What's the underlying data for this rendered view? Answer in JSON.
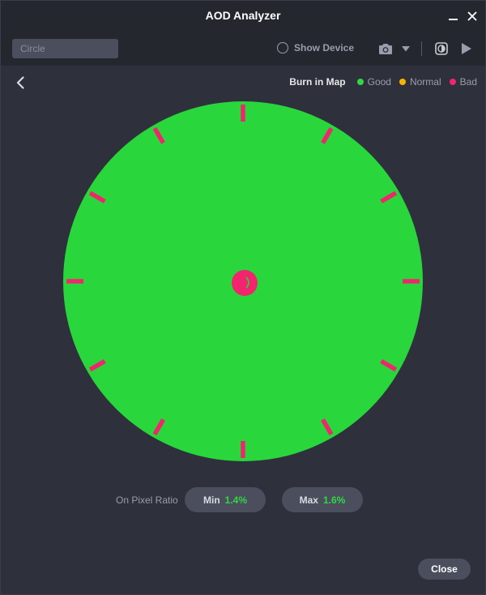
{
  "window": {
    "title": "AOD Analyzer"
  },
  "toolbar": {
    "search_placeholder": "Circle",
    "show_device_label": "Show Device"
  },
  "legend": {
    "title": "Burn in Map",
    "items": [
      {
        "label": "Good",
        "color": "#31d843"
      },
      {
        "label": "Normal",
        "color": "#f5b400"
      },
      {
        "label": "Bad",
        "color": "#f0256e"
      }
    ]
  },
  "burn_map": {
    "shape": "circle",
    "good_color": "#29d63c",
    "bad_color": "#f0256e",
    "hour_marks": 12
  },
  "pixel_ratio": {
    "label": "On Pixel Ratio",
    "min_label": "Min",
    "min_value": "1.4%",
    "max_label": "Max",
    "max_value": "1.6%"
  },
  "footer": {
    "close_label": "Close"
  }
}
